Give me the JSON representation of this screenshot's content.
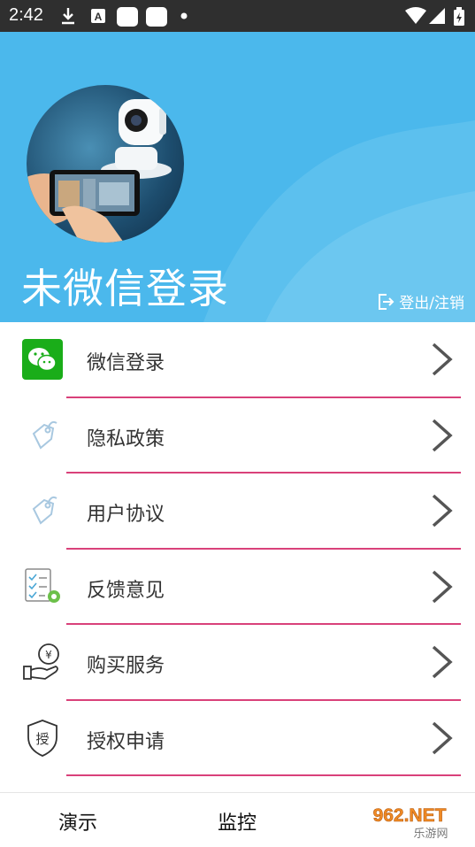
{
  "status_bar": {
    "time": "2:42",
    "icons": [
      "download-icon",
      "a-icon",
      "app-square-icon",
      "app-square-icon",
      "dot-icon",
      "wifi-icon",
      "signal-icon",
      "battery-icon"
    ]
  },
  "header": {
    "title": "未微信登录",
    "logout_label": "登出/注销",
    "background_color": "#4bb8ec"
  },
  "menu": {
    "items": [
      {
        "label": "微信登录",
        "icon": "wechat-icon"
      },
      {
        "label": "隐私政策",
        "icon": "tag-icon"
      },
      {
        "label": "用户协议",
        "icon": "tag-icon"
      },
      {
        "label": "反馈意见",
        "icon": "checklist-icon"
      },
      {
        "label": "购买服务",
        "icon": "purchase-icon"
      },
      {
        "label": "授权申请",
        "icon": "shield-icon"
      }
    ],
    "divider_color": "#d9417a"
  },
  "tabbar": {
    "tabs": [
      {
        "label": "演示"
      },
      {
        "label": "监控"
      }
    ]
  },
  "watermark": {
    "text_top": "962.NET",
    "text_bottom": "乐游网"
  }
}
